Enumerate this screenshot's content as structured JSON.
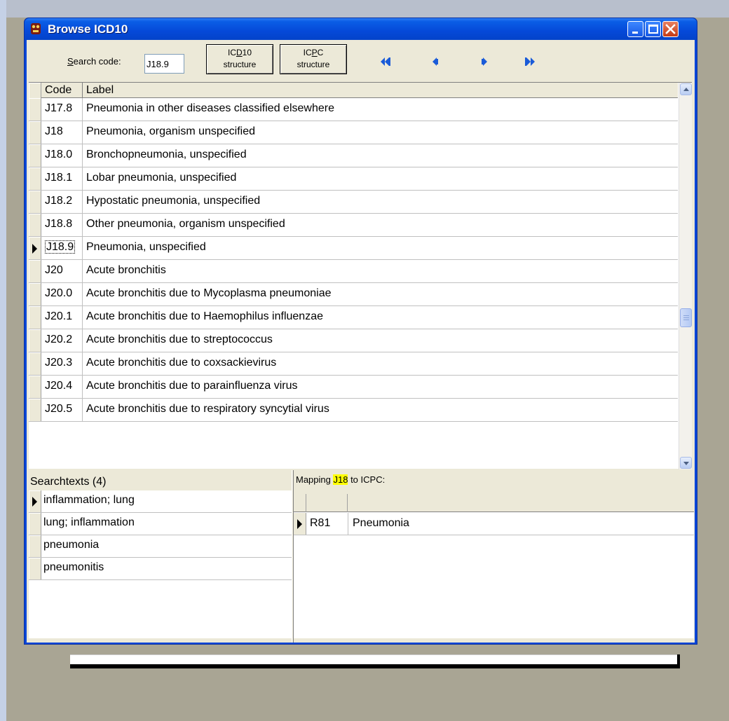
{
  "window": {
    "title": "Browse ICD10"
  },
  "toolbar": {
    "search_label_pre": "",
    "search_label_u": "S",
    "search_label_post": "earch code:",
    "search_value": "J18.9",
    "icd_button": {
      "l1a": "IC",
      "l1u": "D",
      "l1b": "10",
      "line2": "structure"
    },
    "icpc_button": {
      "l1a": "IC",
      "l1u": "P",
      "l1b": "C",
      "line2": "structure"
    },
    "nav": [
      "first-record-icon",
      "prior-record-icon",
      "next-record-icon",
      "last-record-icon"
    ],
    "nav_color": "#1a5bd8"
  },
  "codes_grid": {
    "columns": [
      "Code",
      "Label"
    ],
    "selected_code": "J18.9",
    "rows": [
      {
        "code": "J17.8",
        "label": "Pneumonia in other diseases classified elsewhere"
      },
      {
        "code": "J18",
        "label": "Pneumonia, organism unspecified"
      },
      {
        "code": "J18.0",
        "label": "Bronchopneumonia, unspecified"
      },
      {
        "code": "J18.1",
        "label": "Lobar pneumonia, unspecified"
      },
      {
        "code": "J18.2",
        "label": "Hypostatic pneumonia, unspecified"
      },
      {
        "code": "J18.8",
        "label": "Other pneumonia, organism unspecified"
      },
      {
        "code": "J18.9",
        "label": "Pneumonia, unspecified"
      },
      {
        "code": "J20",
        "label": "Acute bronchitis"
      },
      {
        "code": "J20.0",
        "label": "Acute bronchitis due to Mycoplasma pneumoniae"
      },
      {
        "code": "J20.1",
        "label": "Acute bronchitis due to Haemophilus influenzae"
      },
      {
        "code": "J20.2",
        "label": "Acute bronchitis due to streptococcus"
      },
      {
        "code": "J20.3",
        "label": "Acute bronchitis due to coxsackievirus"
      },
      {
        "code": "J20.4",
        "label": "Acute bronchitis due to parainfluenza virus"
      },
      {
        "code": "J20.5",
        "label": "Acute bronchitis due to respiratory syncytial virus"
      }
    ]
  },
  "searchtexts": {
    "header": "Searchtexts (4)",
    "selected_index": 0,
    "items": [
      "inflammation; lung",
      "lung; inflammation",
      "pneumonia",
      "pneumonitis"
    ]
  },
  "mapping": {
    "header_pre": "Mapping ",
    "header_code": "J18",
    "header_post": " to ICPC:",
    "highlight_color": "#ffff00",
    "rows": [
      {
        "code": "R81",
        "label": "Pneumonia"
      }
    ]
  }
}
